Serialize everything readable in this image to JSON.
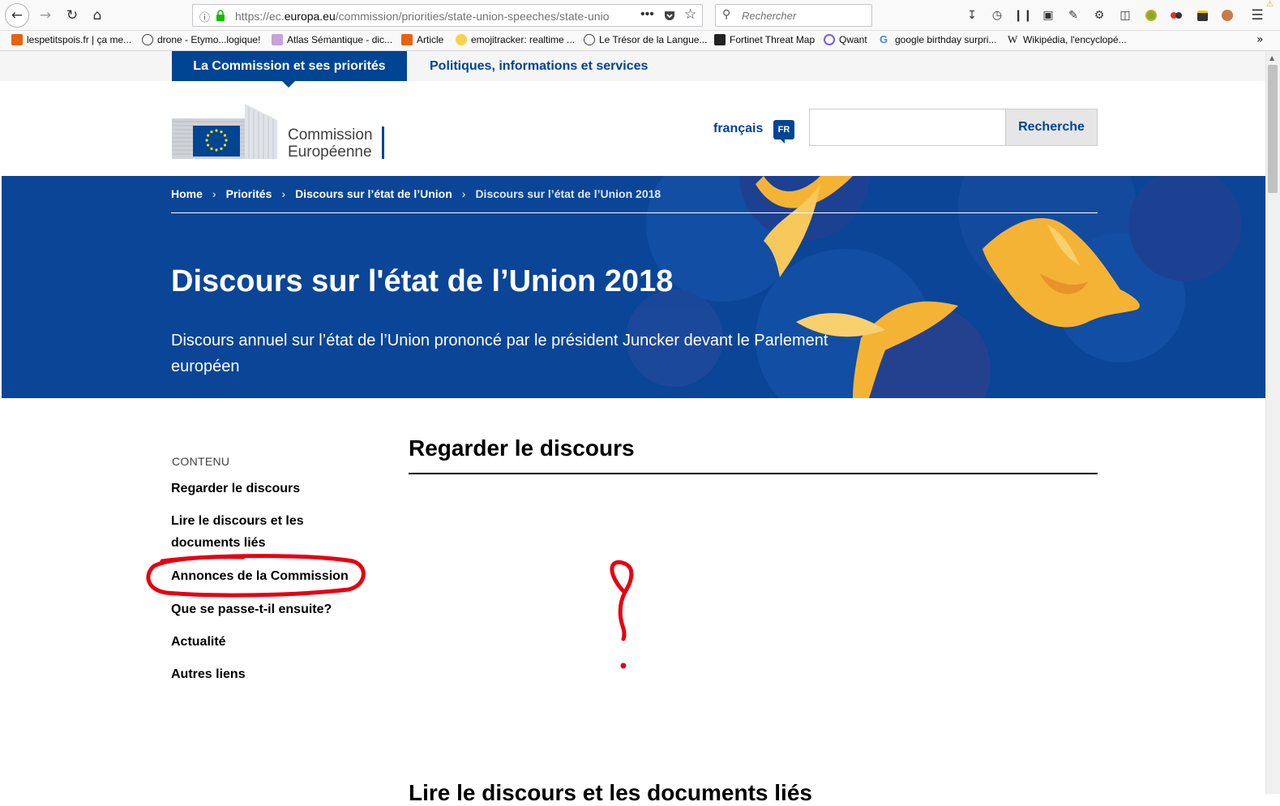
{
  "browser": {
    "url_prefix": "https://ec.",
    "url_domain": "europa.eu",
    "url_path": "/commission/priorities/state-union-speeches/state-unio",
    "search_placeholder": "Rechercher",
    "bookmarks": [
      {
        "label": "lespetitspois.fr | ça me...",
        "icon": "orange-square-icon"
      },
      {
        "label": "drone - Etymo...logique!",
        "icon": "globe-icon"
      },
      {
        "label": "Atlas Sémantique - dic...",
        "icon": "atlas-icon"
      },
      {
        "label": "Article",
        "icon": "orange-square-icon"
      },
      {
        "label": "emojitracker: realtime ...",
        "icon": "emoji-icon"
      },
      {
        "label": "Le Trésor de la Langue...",
        "icon": "globe-icon"
      },
      {
        "label": "Fortinet Threat Map",
        "icon": "fortinet-icon"
      },
      {
        "label": "Qwant",
        "icon": "qwant-icon"
      },
      {
        "label": "google birthday surpri...",
        "icon": "google-icon"
      },
      {
        "label": "Wikipédia, l'encyclopé...",
        "icon": "wikipedia-icon"
      }
    ]
  },
  "site": {
    "nav_tab_active": "La Commission et ses priorités",
    "nav_tab_other": "Politiques, informations et services",
    "logo_line1": "Commission",
    "logo_line2": "Européenne",
    "language": "français",
    "language_code": "FR",
    "search_button": "Recherche"
  },
  "breadcrumb": [
    "Home",
    "Priorités",
    "Discours sur l’état de l’Union",
    "Discours sur l’état de l’Union 2018"
  ],
  "hero": {
    "title": "Discours sur l'état de l’Union 2018",
    "subtitle": "Discours annuel sur l’état de l’Union prononcé par le président Juncker devant le Parlement européen"
  },
  "sidebar": {
    "label": "CONTENU",
    "items": [
      "Regarder le discours",
      "Lire le discours et les documents liés",
      "Annonces de la Commission",
      "Que se passe-t-il ensuite?",
      "Actualité",
      "Autres liens"
    ]
  },
  "main": {
    "section_title": "Regarder le discours",
    "next_section_title": "Lire le discours et les documents liés"
  },
  "colors": {
    "eu_blue": "#004494",
    "hero_blue": "#0a4597",
    "annotation_red": "#e60012"
  }
}
